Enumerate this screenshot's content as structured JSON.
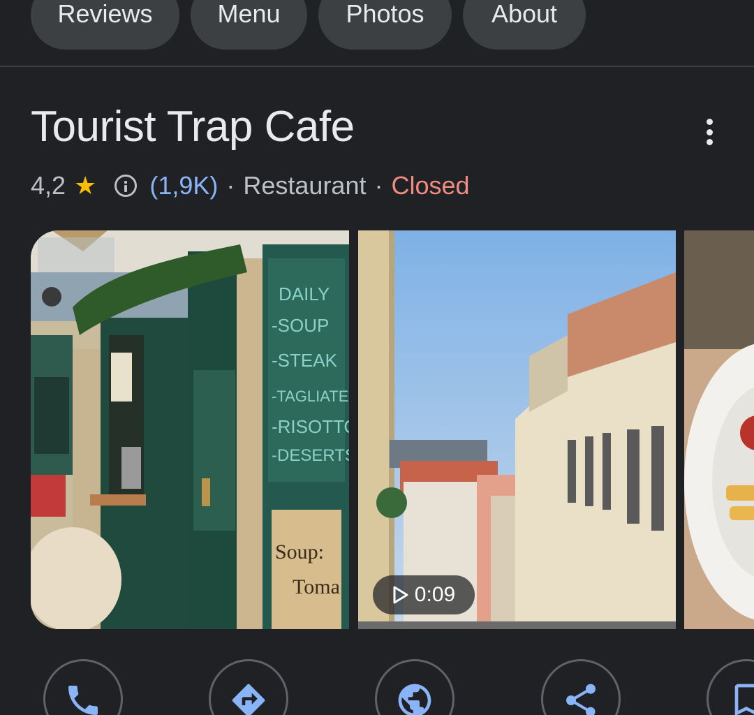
{
  "tabs": [
    {
      "label": "Reviews"
    },
    {
      "label": "Menu"
    },
    {
      "label": "Photos"
    },
    {
      "label": "About"
    }
  ],
  "place": {
    "name": "Tourist Trap Cafe",
    "rating": "4,2",
    "review_count": "(1,9K)",
    "separator": "·",
    "category": "Restaurant",
    "status": "Closed"
  },
  "photos": {
    "video_duration": "0:09"
  },
  "actions": [
    {
      "icon": "phone-icon"
    },
    {
      "icon": "directions-icon"
    },
    {
      "icon": "website-icon"
    },
    {
      "icon": "share-icon"
    },
    {
      "icon": "bookmark-icon"
    }
  ],
  "colors": {
    "background": "#202124",
    "chip": "#3c4043",
    "link": "#8ab4f8",
    "closed": "#f28b82",
    "star": "#fbbc04",
    "action_icon": "#8ab4f8"
  }
}
